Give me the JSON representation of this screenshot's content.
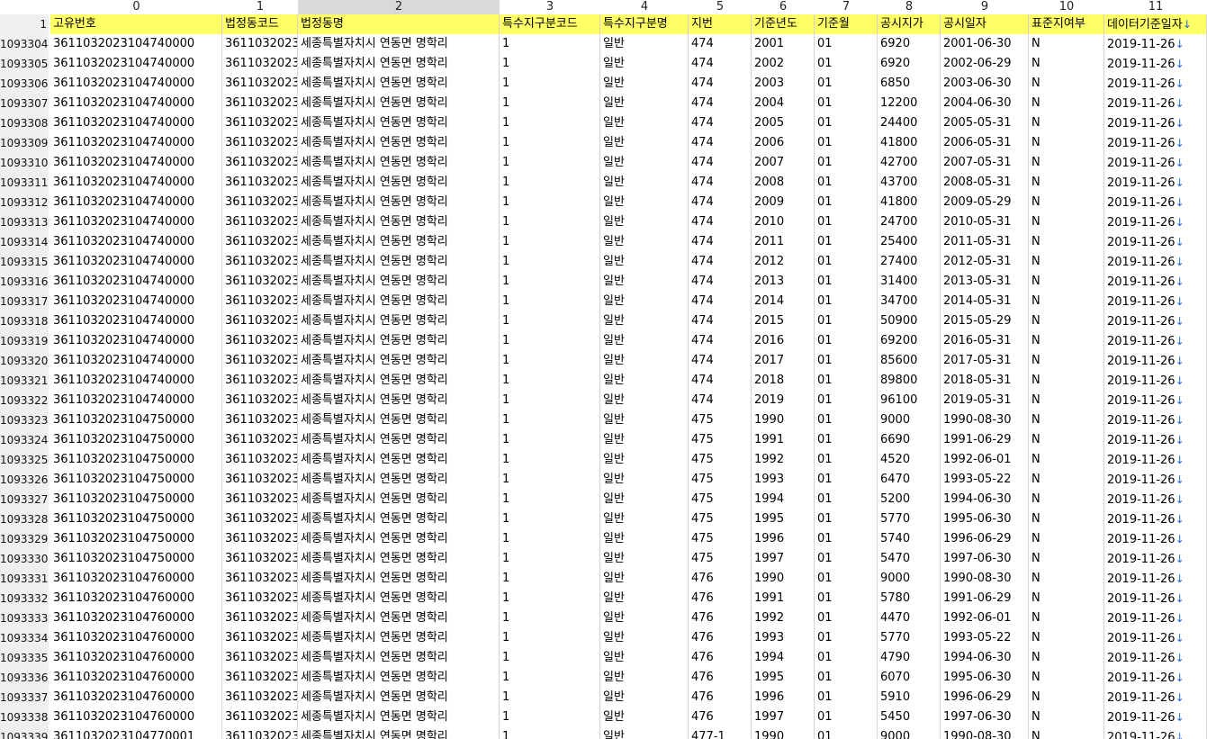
{
  "column_indices": [
    "0",
    "1",
    "2",
    "3",
    "4",
    "5",
    "6",
    "7",
    "8",
    "9",
    "10",
    "11"
  ],
  "selected_column": "2",
  "header_row": {
    "row_number": "1",
    "cells": [
      "고유번호",
      "법정동코드",
      "법정동명",
      "특수지구분코드",
      "특수지구분명",
      "지번",
      "기준년도",
      "기준월",
      "공시지가",
      "공시일자",
      "표준지여부",
      "데이터기준일자"
    ]
  },
  "rows": [
    [
      "1093304",
      "361103202310474​0000",
      "3611032023",
      "세종특별자치시  연동면 명학리",
      "1",
      "일반",
      "474",
      "2001",
      "01",
      "6920",
      "2001-06-30",
      "N",
      "2019-11-26"
    ],
    [
      "1093305",
      "3611032023104740000",
      "3611032023",
      "세종특별자치시  연동면 명학리",
      "1",
      "일반",
      "474",
      "2002",
      "01",
      "6920",
      "2002-06-29",
      "N",
      "2019-11-26"
    ],
    [
      "1093306",
      "3611032023104740000",
      "3611032023",
      "세종특별자치시  연동면 명학리",
      "1",
      "일반",
      "474",
      "2003",
      "01",
      "6850",
      "2003-06-30",
      "N",
      "2019-11-26"
    ],
    [
      "1093307",
      "3611032023104740000",
      "3611032023",
      "세종특별자치시  연동면 명학리",
      "1",
      "일반",
      "474",
      "2004",
      "01",
      "12200",
      "2004-06-30",
      "N",
      "2019-11-26"
    ],
    [
      "1093308",
      "3611032023104740000",
      "3611032023",
      "세종특별자치시  연동면 명학리",
      "1",
      "일반",
      "474",
      "2005",
      "01",
      "24400",
      "2005-05-31",
      "N",
      "2019-11-26"
    ],
    [
      "1093309",
      "3611032023104740000",
      "3611032023",
      "세종특별자치시  연동면 명학리",
      "1",
      "일반",
      "474",
      "2006",
      "01",
      "41800",
      "2006-05-31",
      "N",
      "2019-11-26"
    ],
    [
      "1093310",
      "3611032023104740000",
      "3611032023",
      "세종특별자치시  연동면 명학리",
      "1",
      "일반",
      "474",
      "2007",
      "01",
      "42700",
      "2007-05-31",
      "N",
      "2019-11-26"
    ],
    [
      "1093311",
      "3611032023104740000",
      "3611032023",
      "세종특별자치시  연동면 명학리",
      "1",
      "일반",
      "474",
      "2008",
      "01",
      "43700",
      "2008-05-31",
      "N",
      "2019-11-26"
    ],
    [
      "1093312",
      "3611032023104740000",
      "3611032023",
      "세종특별자치시  연동면 명학리",
      "1",
      "일반",
      "474",
      "2009",
      "01",
      "41800",
      "2009-05-29",
      "N",
      "2019-11-26"
    ],
    [
      "1093313",
      "3611032023104740000",
      "3611032023",
      "세종특별자치시  연동면 명학리",
      "1",
      "일반",
      "474",
      "2010",
      "01",
      "24700",
      "2010-05-31",
      "N",
      "2019-11-26"
    ],
    [
      "1093314",
      "3611032023104740000",
      "3611032023",
      "세종특별자치시  연동면 명학리",
      "1",
      "일반",
      "474",
      "2011",
      "01",
      "25400",
      "2011-05-31",
      "N",
      "2019-11-26"
    ],
    [
      "1093315",
      "3611032023104740000",
      "3611032023",
      "세종특별자치시  연동면 명학리",
      "1",
      "일반",
      "474",
      "2012",
      "01",
      "27400",
      "2012-05-31",
      "N",
      "2019-11-26"
    ],
    [
      "1093316",
      "3611032023104740000",
      "3611032023",
      "세종특별자치시  연동면 명학리",
      "1",
      "일반",
      "474",
      "2013",
      "01",
      "31400",
      "2013-05-31",
      "N",
      "2019-11-26"
    ],
    [
      "1093317",
      "3611032023104740000",
      "3611032023",
      "세종특별자치시  연동면 명학리",
      "1",
      "일반",
      "474",
      "2014",
      "01",
      "34700",
      "2014-05-31",
      "N",
      "2019-11-26"
    ],
    [
      "1093318",
      "3611032023104740000",
      "3611032023",
      "세종특별자치시  연동면 명학리",
      "1",
      "일반",
      "474",
      "2015",
      "01",
      "50900",
      "2015-05-29",
      "N",
      "2019-11-26"
    ],
    [
      "1093319",
      "3611032023104740000",
      "3611032023",
      "세종특별자치시  연동면 명학리",
      "1",
      "일반",
      "474",
      "2016",
      "01",
      "69200",
      "2016-05-31",
      "N",
      "2019-11-26"
    ],
    [
      "1093320",
      "3611032023104740000",
      "3611032023",
      "세종특별자치시  연동면 명학리",
      "1",
      "일반",
      "474",
      "2017",
      "01",
      "85600",
      "2017-05-31",
      "N",
      "2019-11-26"
    ],
    [
      "1093321",
      "3611032023104740000",
      "3611032023",
      "세종특별자치시  연동면 명학리",
      "1",
      "일반",
      "474",
      "2018",
      "01",
      "89800",
      "2018-05-31",
      "N",
      "2019-11-26"
    ],
    [
      "1093322",
      "3611032023104740000",
      "3611032023",
      "세종특별자치시  연동면 명학리",
      "1",
      "일반",
      "474",
      "2019",
      "01",
      "96100",
      "2019-05-31",
      "N",
      "2019-11-26"
    ],
    [
      "1093323",
      "3611032023104750000",
      "3611032023",
      "세종특별자치시  연동면 명학리",
      "1",
      "일반",
      "475",
      "1990",
      "01",
      "9000",
      "1990-08-30",
      "N",
      "2019-11-26"
    ],
    [
      "1093324",
      "3611032023104750000",
      "3611032023",
      "세종특별자치시  연동면 명학리",
      "1",
      "일반",
      "475",
      "1991",
      "01",
      "6690",
      "1991-06-29",
      "N",
      "2019-11-26"
    ],
    [
      "1093325",
      "3611032023104750000",
      "3611032023",
      "세종특별자치시  연동면 명학리",
      "1",
      "일반",
      "475",
      "1992",
      "01",
      "4520",
      "1992-06-01",
      "N",
      "2019-11-26"
    ],
    [
      "1093326",
      "3611032023104750000",
      "3611032023",
      "세종특별자치시  연동면 명학리",
      "1",
      "일반",
      "475",
      "1993",
      "01",
      "6470",
      "1993-05-22",
      "N",
      "2019-11-26"
    ],
    [
      "1093327",
      "3611032023104750000",
      "3611032023",
      "세종특별자치시  연동면 명학리",
      "1",
      "일반",
      "475",
      "1994",
      "01",
      "5200",
      "1994-06-30",
      "N",
      "2019-11-26"
    ],
    [
      "1093328",
      "3611032023104750000",
      "3611032023",
      "세종특별자치시  연동면 명학리",
      "1",
      "일반",
      "475",
      "1995",
      "01",
      "5770",
      "1995-06-30",
      "N",
      "2019-11-26"
    ],
    [
      "1093329",
      "3611032023104750000",
      "3611032023",
      "세종특별자치시  연동면 명학리",
      "1",
      "일반",
      "475",
      "1996",
      "01",
      "5740",
      "1996-06-29",
      "N",
      "2019-11-26"
    ],
    [
      "1093330",
      "3611032023104750000",
      "3611032023",
      "세종특별자치시  연동면 명학리",
      "1",
      "일반",
      "475",
      "1997",
      "01",
      "5470",
      "1997-06-30",
      "N",
      "2019-11-26"
    ],
    [
      "1093331",
      "3611032023104760000",
      "3611032023",
      "세종특별자치시  연동면 명학리",
      "1",
      "일반",
      "476",
      "1990",
      "01",
      "9000",
      "1990-08-30",
      "N",
      "2019-11-26"
    ],
    [
      "1093332",
      "3611032023104760000",
      "3611032023",
      "세종특별자치시  연동면 명학리",
      "1",
      "일반",
      "476",
      "1991",
      "01",
      "5780",
      "1991-06-29",
      "N",
      "2019-11-26"
    ],
    [
      "1093333",
      "3611032023104760000",
      "3611032023",
      "세종특별자치시  연동면 명학리",
      "1",
      "일반",
      "476",
      "1992",
      "01",
      "4470",
      "1992-06-01",
      "N",
      "2019-11-26"
    ],
    [
      "1093334",
      "3611032023104760000",
      "3611032023",
      "세종특별자치시  연동면 명학리",
      "1",
      "일반",
      "476",
      "1993",
      "01",
      "5770",
      "1993-05-22",
      "N",
      "2019-11-26"
    ],
    [
      "1093335",
      "3611032023104760000",
      "3611032023",
      "세종특별자치시  연동면 명학리",
      "1",
      "일반",
      "476",
      "1994",
      "01",
      "4790",
      "1994-06-30",
      "N",
      "2019-11-26"
    ],
    [
      "1093336",
      "3611032023104760000",
      "3611032023",
      "세종특별자치시  연동면 명학리",
      "1",
      "일반",
      "476",
      "1995",
      "01",
      "6070",
      "1995-06-30",
      "N",
      "2019-11-26"
    ],
    [
      "1093337",
      "3611032023104760000",
      "3611032023",
      "세종특별자치시  연동면 명학리",
      "1",
      "일반",
      "476",
      "1996",
      "01",
      "5910",
      "1996-06-29",
      "N",
      "2019-11-26"
    ],
    [
      "1093338",
      "3611032023104760000",
      "3611032023",
      "세종특별자치시  연동면 명학리",
      "1",
      "일반",
      "476",
      "1997",
      "01",
      "5450",
      "1997-06-30",
      "N",
      "2019-11-26"
    ],
    [
      "1093339",
      "3611032023104770001",
      "3611032023",
      "세종특별자치시  연동면 명학리",
      "1",
      "일반",
      "477-1",
      "1990",
      "01",
      "9000",
      "1990-08-30",
      "N",
      "2019-11-26"
    ]
  ],
  "line_end_glyph": "↓",
  "header_bg_color": "#ffff66",
  "selected_header_color": "#d9d9d9",
  "arrow_color": "#1e6bd6"
}
